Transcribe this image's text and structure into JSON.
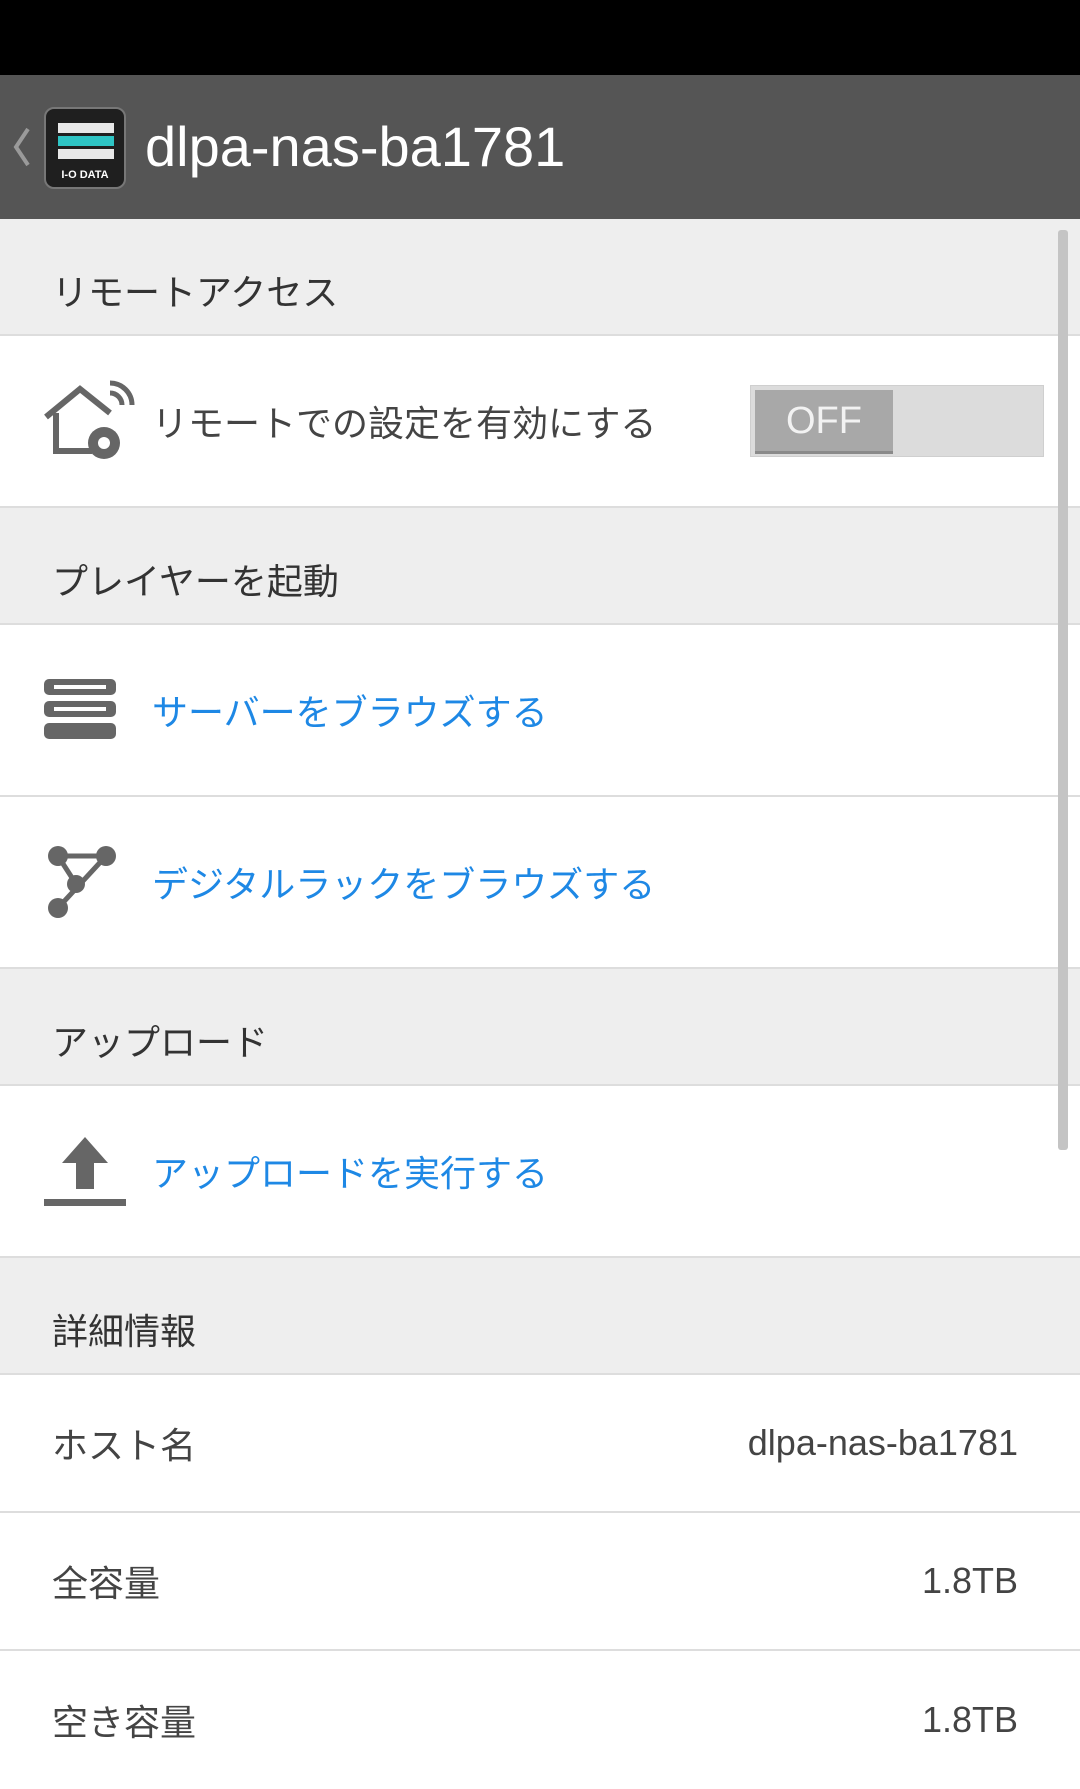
{
  "action_bar": {
    "title": "dlpa-nas-ba1781",
    "logo_text": "I-O DATA"
  },
  "sections": {
    "remote_access": {
      "header": "リモートアクセス",
      "remote_setting_label": "リモートでの設定を有効にする",
      "toggle_state": "OFF"
    },
    "player": {
      "header": "プレイヤーを起動",
      "browse_server_label": "サーバーをブラウズする",
      "browse_digital_rack_label": "デジタルラックをブラウズする"
    },
    "upload": {
      "header": "アップロード",
      "run_upload_label": "アップロードを実行する"
    },
    "details": {
      "header": "詳細情報",
      "rows": [
        {
          "key": "ホスト名",
          "value": "dlpa-nas-ba1781"
        },
        {
          "key": "全容量",
          "value": "1.8TB"
        },
        {
          "key": "空き容量",
          "value": "1.8TB"
        }
      ]
    }
  },
  "colors": {
    "action_bar": "#555555",
    "link_blue": "#1e88e5",
    "section_bg": "#eeeeee"
  }
}
